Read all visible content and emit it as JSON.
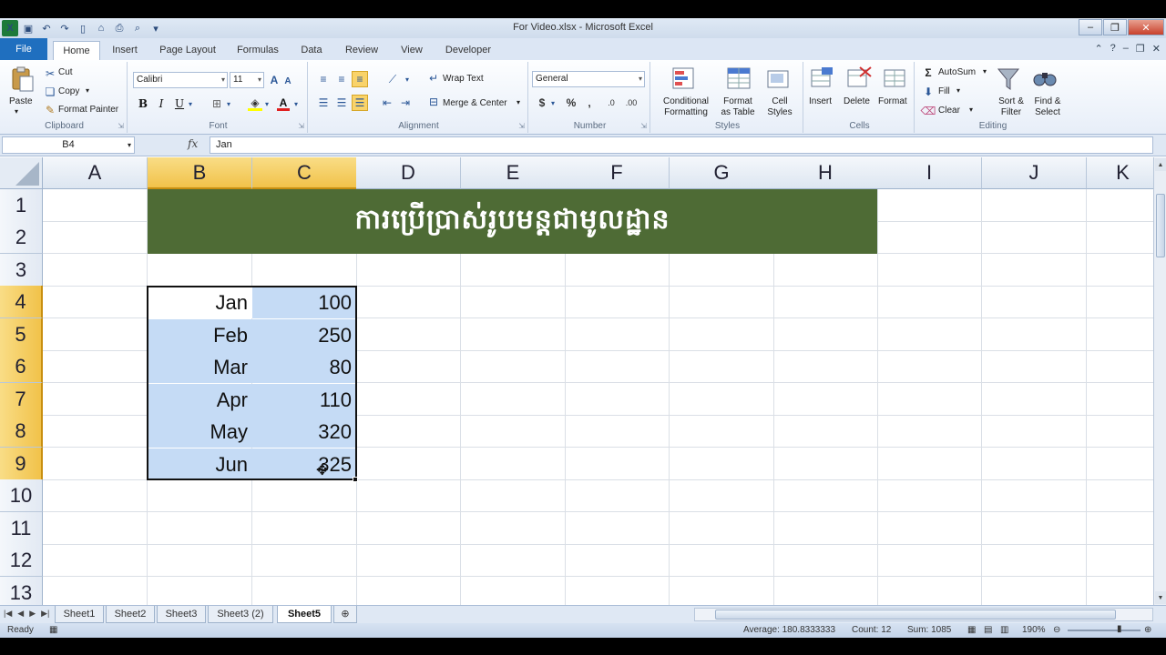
{
  "window": {
    "title": "For Video.xlsx  -  Microsoft Excel"
  },
  "tabs": [
    "File",
    "Home",
    "Insert",
    "Page Layout",
    "Formulas",
    "Data",
    "Review",
    "View",
    "Developer"
  ],
  "ribbon": {
    "clipboard": {
      "paste": "Paste",
      "cut": "Cut",
      "copy": "Copy",
      "format_painter": "Format Painter",
      "label": "Clipboard"
    },
    "font": {
      "name": "Calibri",
      "size": "11",
      "label": "Font"
    },
    "alignment": {
      "wrap_text": "Wrap Text",
      "merge_center": "Merge & Center",
      "label": "Alignment"
    },
    "number": {
      "format": "General",
      "label": "Number"
    },
    "styles": {
      "conditional_formatting": "Conditional\nFormatting",
      "format_as_table": "Format\nas Table",
      "cell_styles": "Cell\nStyles",
      "label": "Styles"
    },
    "cells": {
      "insert": "Insert",
      "delete": "Delete",
      "format": "Format",
      "label": "Cells"
    },
    "editing": {
      "autosum": "AutoSum",
      "fill": "Fill",
      "clear": "Clear",
      "sort_filter": "Sort &\nFilter",
      "find_select": "Find &\nSelect",
      "label": "Editing"
    }
  },
  "formula_bar": {
    "name_box": "B4",
    "fx": "fx",
    "value": "Jan"
  },
  "grid": {
    "columns": [
      "A",
      "B",
      "C",
      "D",
      "E",
      "F",
      "G",
      "H",
      "I",
      "J",
      "K"
    ],
    "rows": [
      "1",
      "2",
      "3",
      "4",
      "5",
      "6",
      "7",
      "8",
      "9",
      "10",
      "11",
      "12",
      "13"
    ],
    "title": "ការប្រើប្រាស់រូបមន្តជាមូលដ្ឋាន",
    "data": [
      {
        "month": "Jan",
        "value": "100"
      },
      {
        "month": "Feb",
        "value": "250"
      },
      {
        "month": "Mar",
        "value": "80"
      },
      {
        "month": "Apr",
        "value": "110"
      },
      {
        "month": "May",
        "value": "320"
      },
      {
        "month": "Jun",
        "value": "325"
      }
    ]
  },
  "sheets": [
    "Sheet1",
    "Sheet2",
    "Sheet3",
    "Sheet3 (2)",
    "Sheet5"
  ],
  "active_sheet": "Sheet5",
  "status": {
    "ready": "Ready",
    "average": "Average: 180.8333333",
    "count": "Count: 12",
    "sum": "Sum: 1085",
    "zoom": "190%"
  },
  "colors": {
    "title_fill": "#4e6b35",
    "selection_fill": "#c5dbf5",
    "header_selected": "#f1c24a"
  }
}
